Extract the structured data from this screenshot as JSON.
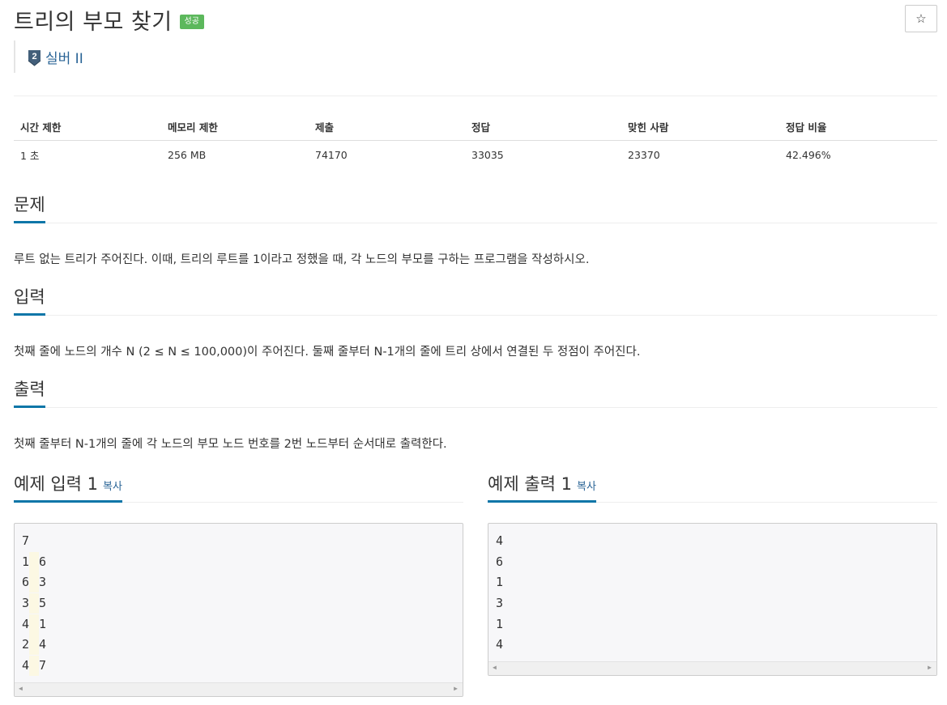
{
  "problem": {
    "title": "트리의 부모 찾기",
    "status_badge": "성공",
    "star_icon": "☆",
    "tier": {
      "label": "실버 II",
      "icon_number": "2"
    }
  },
  "stats": {
    "headers": [
      "시간 제한",
      "메모리 제한",
      "제출",
      "정답",
      "맞힌 사람",
      "정답 비율"
    ],
    "values": [
      "1 초",
      "256 MB",
      "74170",
      "33035",
      "23370",
      "42.496%"
    ]
  },
  "sections": {
    "description": {
      "heading": "문제",
      "text": "루트 없는 트리가 주어진다. 이때, 트리의 루트를 1이라고 정했을 때, 각 노드의 부모를 구하는 프로그램을 작성하시오."
    },
    "input": {
      "heading": "입력",
      "text": "첫째 줄에 노드의 개수 N (2 ≤ N ≤ 100,000)이 주어진다. 둘째 줄부터 N-1개의 줄에 트리 상에서 연결된 두 정점이 주어진다."
    },
    "output": {
      "heading": "출력",
      "text": "첫째 줄부터 N-1개의 줄에 각 노드의 부모 노드 번호를 2번 노드부터 순서대로 출력한다."
    }
  },
  "samples": {
    "input": {
      "heading": "예제 입력 1",
      "copy_label": "복사",
      "lines": [
        [
          "7"
        ],
        [
          "1",
          "6"
        ],
        [
          "6",
          "3"
        ],
        [
          "3",
          "5"
        ],
        [
          "4",
          "1"
        ],
        [
          "2",
          "4"
        ],
        [
          "4",
          "7"
        ]
      ]
    },
    "output": {
      "heading": "예제 출력 1",
      "copy_label": "복사",
      "lines": [
        [
          "4"
        ],
        [
          "6"
        ],
        [
          "1"
        ],
        [
          "3"
        ],
        [
          "1"
        ],
        [
          "4"
        ]
      ]
    }
  },
  "colors": {
    "accent": "#0e76a8",
    "success": "#5cb85c",
    "link": "#2a6496",
    "tier": "#435f7a"
  }
}
